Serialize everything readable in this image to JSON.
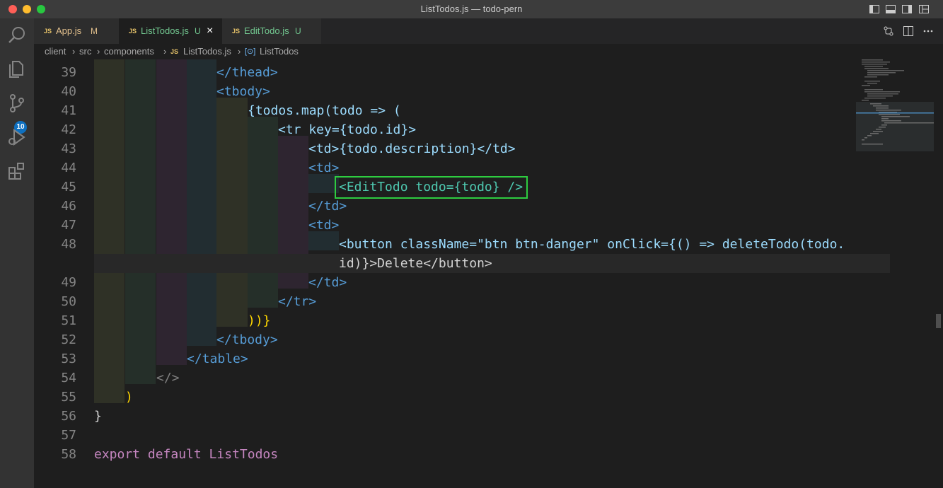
{
  "window": {
    "title": "ListTodos.js — todo-pern",
    "buttons": [
      "red",
      "yellow",
      "green"
    ]
  },
  "activity_bar": {
    "items": [
      {
        "icon": "search-icon"
      },
      {
        "icon": "files-icon"
      },
      {
        "icon": "source-control-icon",
        "badge": "10"
      },
      {
        "icon": "run-debug-icon"
      },
      {
        "icon": "extensions-icon"
      }
    ]
  },
  "tabs": [
    {
      "file_badge": "JS",
      "name": "App.js",
      "status": "M",
      "active": false
    },
    {
      "file_badge": "JS",
      "name": "ListTodos.js",
      "status": "U",
      "active": true
    },
    {
      "file_badge": "JS",
      "name": "EditTodo.js",
      "status": "U",
      "active": false
    }
  ],
  "tab_close": "×",
  "breadcrumbs": [
    "client",
    "src",
    "components",
    "ListTodos.js",
    "ListTodos"
  ],
  "editor": {
    "lines": [
      {
        "n": "39",
        "code": "</thead>"
      },
      {
        "n": "40",
        "code": "<tbody>"
      },
      {
        "n": "41",
        "code": "{todos.map(todo => ("
      },
      {
        "n": "42",
        "code": "<tr key={todo.id}>"
      },
      {
        "n": "43",
        "code": "<td>{todo.description}</td>"
      },
      {
        "n": "44",
        "code": "<td>"
      },
      {
        "n": "45",
        "code": "<EditTodo todo={todo} />"
      },
      {
        "n": "46",
        "code": "</td>"
      },
      {
        "n": "47",
        "code": "<td>"
      },
      {
        "n": "48",
        "code": "<button className=\"btn btn-danger\" onClick={() => deleteTodo(todo."
      },
      {
        "n": "",
        "code": "id)}>Delete</button>"
      },
      {
        "n": "49",
        "code": "</td>"
      },
      {
        "n": "50",
        "code": "</tr>"
      },
      {
        "n": "51",
        "code": "))}"
      },
      {
        "n": "52",
        "code": "</tbody>"
      },
      {
        "n": "53",
        "code": "</table>"
      },
      {
        "n": "54",
        "code": "</>"
      },
      {
        "n": "55",
        "code": ")"
      },
      {
        "n": "56",
        "code": "}"
      },
      {
        "n": "57",
        "code": ""
      },
      {
        "n": "58",
        "code": "export default ListTodos"
      }
    ]
  },
  "colors": {
    "title_bar": "#3c3c3c",
    "activity_bar": "#333333",
    "editor_bg": "#1e1e1e",
    "highlight_box": "#2ecc40",
    "badge": "#0e70c0"
  }
}
